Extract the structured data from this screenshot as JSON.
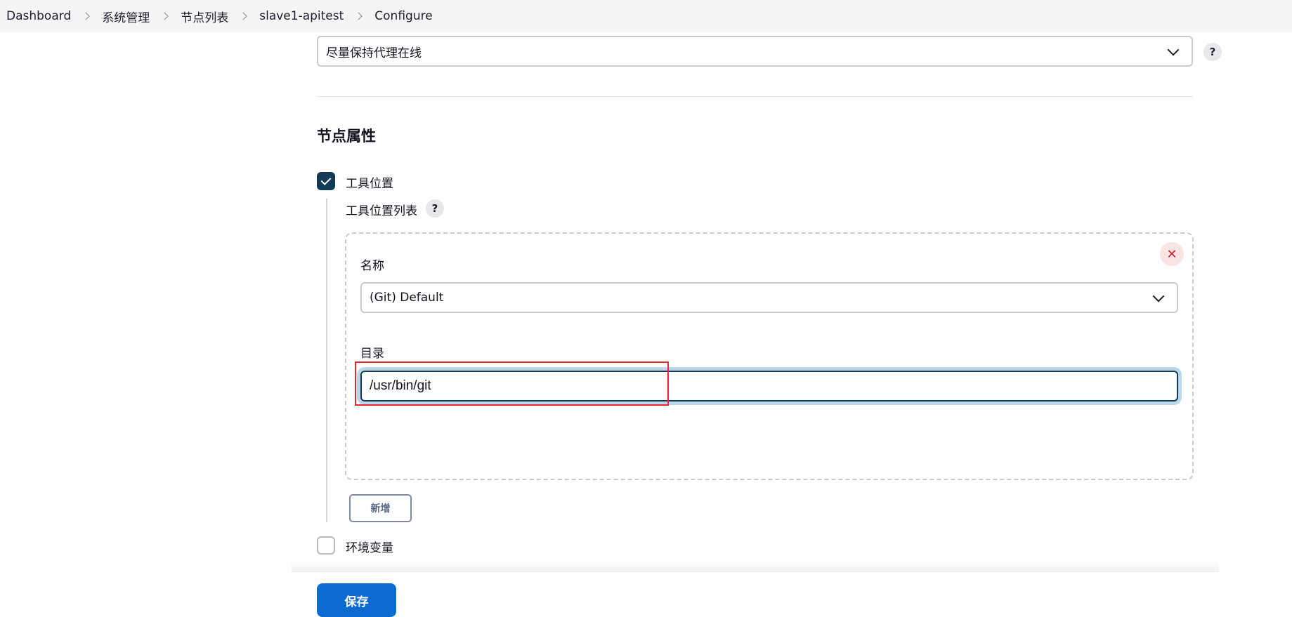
{
  "breadcrumb": {
    "items": [
      "Dashboard",
      "系统管理",
      "节点列表",
      "slave1-apitest",
      "Configure"
    ]
  },
  "availability": {
    "selected": "尽量保持代理在线",
    "help": "?"
  },
  "node_properties": {
    "title": "节点属性",
    "tool_locations": {
      "label": "工具位置",
      "checked": true,
      "list_label": "工具位置列表",
      "help": "?",
      "entry": {
        "delete_symbol": "✕",
        "name_label": "名称",
        "name_selected": "(Git) Default",
        "dir_label": "目录",
        "dir_value": "/usr/bin/git"
      },
      "add_label": "新增"
    },
    "env_vars": {
      "label": "环境变量",
      "checked": false
    }
  },
  "save_label": "保存",
  "colors": {
    "accent": "#0b6bd3",
    "checkbox_checked": "#133a57",
    "annotation": "#e8262b"
  }
}
